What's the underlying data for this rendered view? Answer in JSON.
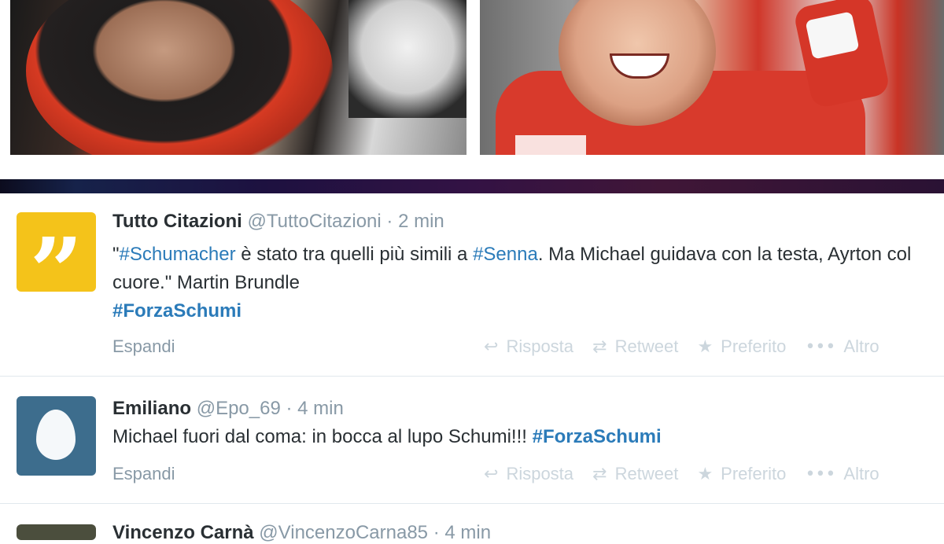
{
  "tweets": [
    {
      "fullname": "Tutto Citazioni",
      "handle": "@TuttoCitazioni",
      "dot": "·",
      "time": "2 min",
      "text": {
        "q_open": "\"",
        "tag1": "#Schumacher",
        "t1": " è stato tra quelli più simili a ",
        "tag2": "#Senna",
        "t2": ". Ma Michael guidava con la testa, Ayrton col cuore.\" Martin Brundle",
        "tag3": "#ForzaSchumi"
      },
      "expand": "Espandi",
      "actions": {
        "reply": "Risposta",
        "retweet": "Retweet",
        "favorite": "Preferito",
        "more": "Altro"
      }
    },
    {
      "fullname": "Emiliano",
      "handle": "@Epo_69",
      "dot": "·",
      "time": "4 min",
      "text": {
        "t1": "Michael fuori dal coma: in bocca al lupo Schumi!!! ",
        "tag1": "#ForzaSchumi"
      },
      "expand": "Espandi",
      "actions": {
        "reply": "Risposta",
        "retweet": "Retweet",
        "favorite": "Preferito",
        "more": "Altro"
      }
    },
    {
      "fullname": "Vincenzo Carnà",
      "handle": "@VincenzoCarna85",
      "dot": "·",
      "time": "4 min"
    }
  ],
  "icons": {
    "reply": "reply-icon",
    "retweet": "retweet-icon",
    "favorite": "star-icon",
    "more": "more-dots-icon"
  },
  "colors": {
    "link": "#2b7bb9",
    "name": "#292f33",
    "meta": "#8899a6",
    "action": "#ccd6dd",
    "avatar_quote_bg": "#f4c31a",
    "avatar_egg_bg": "#3d6d8d"
  }
}
